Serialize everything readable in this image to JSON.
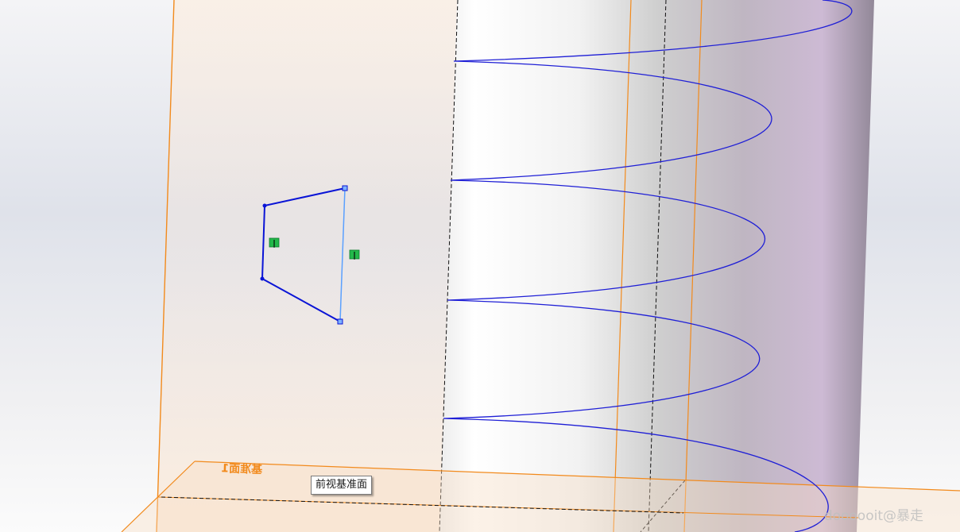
{
  "viewport": {
    "plane_front_label": "前视基准面",
    "plane_label_flipped": "基准面1",
    "watermark": "doooooit@暴走"
  },
  "relations": [
    {
      "icon": "vertical-relation-icon",
      "symbol": "|"
    },
    {
      "icon": "vertical-relation-icon",
      "symbol": "|"
    }
  ],
  "colors": {
    "plane_edge": "#f28a1c",
    "helix": "#1f1fd6",
    "sketch_line": "#0a14d6",
    "construction_line": "#5aa0ff",
    "relation_badge": "#22b84a"
  }
}
